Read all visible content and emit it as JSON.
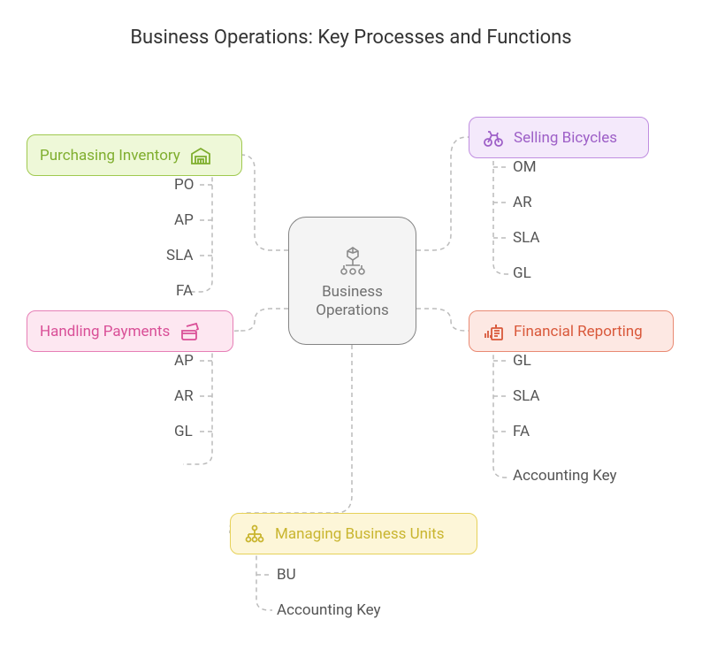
{
  "title": "Business Operations: Key Processes and Functions",
  "center": {
    "label": "Business\nOperations"
  },
  "branches": {
    "purchasing": {
      "label": "Purchasing Inventory",
      "items": [
        "PO",
        "AP",
        "SLA",
        "FA"
      ]
    },
    "handling": {
      "label": "Handling Payments",
      "items": [
        "AP",
        "AR",
        "GL"
      ]
    },
    "selling": {
      "label": "Selling Bicycles",
      "items": [
        "OM",
        "AR",
        "SLA",
        "GL"
      ]
    },
    "financial": {
      "label": "Financial Reporting",
      "items": [
        "GL",
        "SLA",
        "FA",
        "Accounting Key"
      ]
    },
    "managing": {
      "label": "Managing Business Units",
      "items": [
        "BU",
        "Accounting Key"
      ]
    }
  }
}
